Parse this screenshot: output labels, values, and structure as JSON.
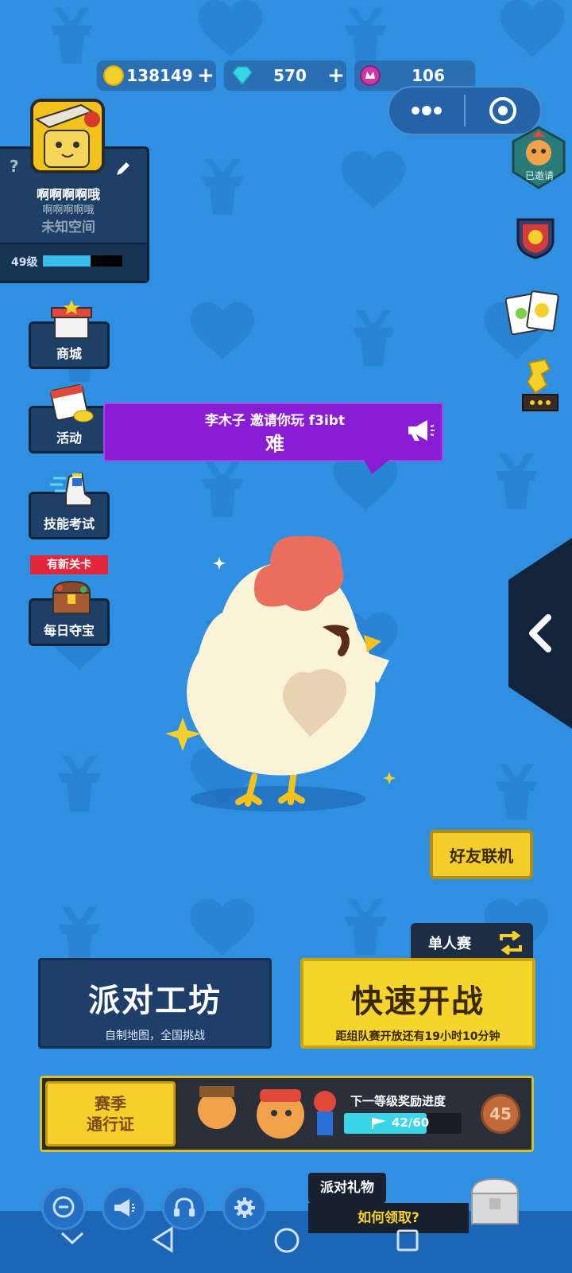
{
  "currency": {
    "coins": "138149",
    "gems": "570",
    "tokens": "106",
    "plus": "+"
  },
  "profile": {
    "name": "啊啊啊啊哦",
    "subname": "啊啊啊啊哦",
    "location": "未知空间",
    "help": "?",
    "level": "49级",
    "level_progress": 0.6
  },
  "menu": {
    "shop": "商城",
    "events": "活动",
    "skill_test": "技能考试",
    "new_level_badge": "有新关卡",
    "daily_treasure": "每日夺宝"
  },
  "right_icons": {
    "invited_label": "已邀请"
  },
  "invite": {
    "line1": "李木子 邀请你玩 f3ibt",
    "line2": "难"
  },
  "buttons": {
    "friend_online": "好友联机",
    "solo": "单人赛",
    "workshop_title": "派对工坊",
    "workshop_sub": "自制地图，全国挑战",
    "quick_title": "快速开战",
    "quick_sub": "距组队赛开放还有19小时10分钟"
  },
  "pass": {
    "title_line1": "赛季",
    "title_line2": "通行证",
    "progress_label": "下一等级奖励进度",
    "progress_text": "42/60",
    "progress": 0.7,
    "level": "45"
  },
  "gift": {
    "title": "派对礼物",
    "how": "如何领取?"
  }
}
